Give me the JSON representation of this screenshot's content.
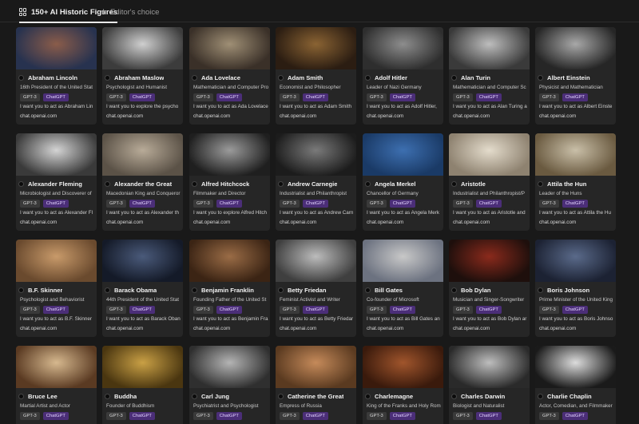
{
  "tabs": [
    {
      "label": "150+ AI Historic Figures",
      "icon": "grid-icon",
      "active": true
    },
    {
      "label": "Editor's choice",
      "icon": "star-icon",
      "active": false
    }
  ],
  "cards": [
    {
      "name": "Abraham Lincoln",
      "description": "16th President of the United Stat",
      "tags": [
        "GPT-3",
        "ChatGPT"
      ],
      "prompt": "I want you to act as Abraham Lin",
      "link": "chat.openai.com",
      "thumb_colors": [
        "#8a5c4a",
        "#27324f"
      ]
    },
    {
      "name": "Abraham Maslow",
      "description": "Psychologist and Humanist",
      "tags": [
        "GPT-3",
        "ChatGPT"
      ],
      "prompt": "I want you to explore the psycho",
      "link": "chat.openai.com",
      "thumb_colors": [
        "#cfcfcf",
        "#3c3c3c"
      ]
    },
    {
      "name": "Ada Lovelace",
      "description": "Mathematician and Computer Pro",
      "tags": [
        "GPT-3",
        "ChatGPT"
      ],
      "prompt": "I want you to act as Ada Lovelace",
      "link": "chat.openai.com",
      "thumb_colors": [
        "#9f8f75",
        "#3a3028"
      ]
    },
    {
      "name": "Adam Smith",
      "description": "Economist and Philosopher",
      "tags": [
        "GPT-3",
        "ChatGPT"
      ],
      "prompt": "I want you to act as Adam Smith",
      "link": "chat.openai.com",
      "thumb_colors": [
        "#8a6333",
        "#2b1d12"
      ]
    },
    {
      "name": "Adolf Hitler",
      "description": "Leader of Nazi Germany",
      "tags": [
        "GPT-3",
        "ChatGPT"
      ],
      "prompt": "I want you to act as Adolf Hitler,",
      "link": "chat.openai.com",
      "thumb_colors": [
        "#8d8d8d",
        "#2e2e2e"
      ]
    },
    {
      "name": "Alan Turin",
      "description": "Mathematician and Computer Sc",
      "tags": [
        "GPT-3",
        "ChatGPT"
      ],
      "prompt": "I want you to act as Alan Turing a",
      "link": "chat.openai.com",
      "thumb_colors": [
        "#bdbdbd",
        "#3a3a3a"
      ]
    },
    {
      "name": "Albert Einstein",
      "description": "Physicist and Mathematician",
      "tags": [
        "GPT-3",
        "ChatGPT"
      ],
      "prompt": "I want you to act as Albert Einste",
      "link": "chat.openai.com",
      "thumb_colors": [
        "#a8a8a8",
        "#262626"
      ]
    },
    {
      "name": "Alexander Fleming",
      "description": "Microbiologist and Discoverer of",
      "tags": [
        "GPT-3",
        "ChatGPT"
      ],
      "prompt": "I want you to act as Alexander Fl",
      "link": "chat.openai.com",
      "thumb_colors": [
        "#d4d4d4",
        "#3a3a3a"
      ]
    },
    {
      "name": "Alexander the Great",
      "description": "Macedonian King and Conqueror",
      "tags": [
        "GPT-3",
        "ChatGPT"
      ],
      "prompt": "I want you to act as Alexander th",
      "link": "chat.openai.com",
      "thumb_colors": [
        "#b8ab98",
        "#5b5247"
      ]
    },
    {
      "name": "Alfred Hitchcock",
      "description": "Filmmaker and Director",
      "tags": [
        "GPT-3",
        "ChatGPT"
      ],
      "prompt": "I want you to explore Alfred Hitch",
      "link": "chat.openai.com",
      "thumb_colors": [
        "#9b9b9b",
        "#1f1f1f"
      ]
    },
    {
      "name": "Andrew Carnegie",
      "description": "Industrialist and Philanthropist",
      "tags": [
        "GPT-3",
        "ChatGPT"
      ],
      "prompt": "I want you to act as Andrew Carn",
      "link": "chat.openai.com",
      "thumb_colors": [
        "#7a7a7a",
        "#1c1c1c"
      ]
    },
    {
      "name": "Angela Merkel",
      "description": "Chancellor of Germany",
      "tags": [
        "GPT-3",
        "ChatGPT"
      ],
      "prompt": "I want you to act as Angela Merk",
      "link": "chat.openai.com",
      "thumb_colors": [
        "#3d6fb0",
        "#1a3a66"
      ]
    },
    {
      "name": "Aristotle",
      "description": "Industrialist and Philanthropist/P",
      "tags": [
        "GPT-3",
        "ChatGPT"
      ],
      "prompt": "I want you to act as Aristotle and",
      "link": "chat.openai.com",
      "thumb_colors": [
        "#e4dccc",
        "#8e8270"
      ]
    },
    {
      "name": "Attila the Hun",
      "description": "Leader of the Huns",
      "tags": [
        "GPT-3",
        "ChatGPT"
      ],
      "prompt": "I want you to act as Attila the Hu",
      "link": "chat.openai.com",
      "thumb_colors": [
        "#c9bfa8",
        "#6a5a40"
      ]
    },
    {
      "name": "B.F. Skinner",
      "description": "Psychologist and Behaviorist",
      "tags": [
        "GPT-3",
        "ChatGPT"
      ],
      "prompt": "I want you to act as B.F. Skinner",
      "link": "chat.openai.com",
      "thumb_colors": [
        "#c89a6a",
        "#6a4a2e"
      ]
    },
    {
      "name": "Barack Obama",
      "description": "44th President of the United Stat",
      "tags": [
        "GPT-3",
        "ChatGPT"
      ],
      "prompt": "I want you to act as Barack Oban",
      "link": "chat.openai.com",
      "thumb_colors": [
        "#4a5a7a",
        "#141a28"
      ]
    },
    {
      "name": "Benjamin Franklin",
      "description": "Founding Father of the United St",
      "tags": [
        "GPT-3",
        "ChatGPT"
      ],
      "prompt": "I want you to act as Benjamin Fra",
      "link": "chat.openai.com",
      "thumb_colors": [
        "#9a6c46",
        "#3b2414"
      ]
    },
    {
      "name": "Betty Friedan",
      "description": "Feminist Activist and Writer",
      "tags": [
        "GPT-3",
        "ChatGPT"
      ],
      "prompt": "I want you to act as Betty Friedar",
      "link": "chat.openai.com",
      "thumb_colors": [
        "#bcbcbc",
        "#3f3f3f"
      ]
    },
    {
      "name": "Bill Gates",
      "description": "Co-founder of Microsoft",
      "tags": [
        "GPT-3",
        "ChatGPT"
      ],
      "prompt": "I want you to act as Bill Gates an",
      "link": "chat.openai.com",
      "thumb_colors": [
        "#c8c8c8",
        "#6c7280"
      ]
    },
    {
      "name": "Bob Dylan",
      "description": "Musician and Singer-Songwriter",
      "tags": [
        "GPT-3",
        "ChatGPT"
      ],
      "prompt": "I want you to act as Bob Dylan ar",
      "link": "chat.openai.com",
      "thumb_colors": [
        "#8a2a1c",
        "#1e0f0c"
      ]
    },
    {
      "name": "Boris Johnson",
      "description": "Prime Minister of the United King",
      "tags": [
        "GPT-3",
        "ChatGPT"
      ],
      "prompt": "I want you to act as Boris Johnso",
      "link": "chat.openai.com",
      "thumb_colors": [
        "#5a6a8a",
        "#1c2233"
      ]
    },
    {
      "name": "Bruce Lee",
      "description": "Martial Artist and Actor",
      "tags": [
        "GPT-3",
        "ChatGPT"
      ],
      "prompt": "",
      "link": "",
      "thumb_colors": [
        "#d6b88e",
        "#5a3a22"
      ]
    },
    {
      "name": "Buddha",
      "description": "Founder of Buddhism",
      "tags": [
        "GPT-3",
        "ChatGPT"
      ],
      "prompt": "",
      "link": "",
      "thumb_colors": [
        "#c9a045",
        "#4a3610"
      ]
    },
    {
      "name": "Carl Jung",
      "description": "Psychiatrist and Psychologist",
      "tags": [
        "GPT-3",
        "ChatGPT"
      ],
      "prompt": "",
      "link": "",
      "thumb_colors": [
        "#b4b4b4",
        "#2f2f2f"
      ]
    },
    {
      "name": "Catherine the Great",
      "description": "Empress of Russia",
      "tags": [
        "GPT-3",
        "ChatGPT"
      ],
      "prompt": "",
      "link": "",
      "thumb_colors": [
        "#c58a5a",
        "#5a3a20"
      ]
    },
    {
      "name": "Charlemagne",
      "description": "King of the Franks and Holy Rom",
      "tags": [
        "GPT-3",
        "ChatGPT"
      ],
      "prompt": "",
      "link": "",
      "thumb_colors": [
        "#a0552c",
        "#3a1a0c"
      ]
    },
    {
      "name": "Charles Darwin",
      "description": "Biologist and Naturalist",
      "tags": [
        "GPT-3",
        "ChatGPT"
      ],
      "prompt": "",
      "link": "",
      "thumb_colors": [
        "#bdbdbd",
        "#2a2a2a"
      ]
    },
    {
      "name": "Charlie Chaplin",
      "description": "Actor, Comedian, and Filmmaker",
      "tags": [
        "GPT-3",
        "ChatGPT"
      ],
      "prompt": "",
      "link": "",
      "thumb_colors": [
        "#dcdcdc",
        "#1a1a1a"
      ]
    }
  ]
}
